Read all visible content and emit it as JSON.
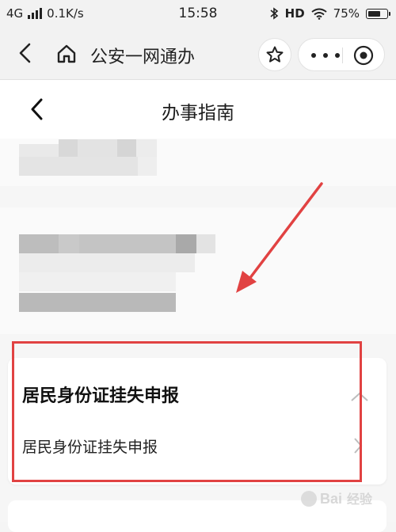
{
  "status_bar": {
    "network": "4G",
    "speed": "0.1K/s",
    "time": "15:58",
    "hd": "HD",
    "battery": "75%",
    "battery_level": 0.75
  },
  "app_bar": {
    "title": "公安一网通办",
    "icons": [
      "back-icon",
      "home-icon",
      "star-icon",
      "more-icon",
      "close-icon"
    ]
  },
  "page_header": {
    "title": "办事指南"
  },
  "section": {
    "heading": "居民身份证挂失申报",
    "sub_item": "居民身份证挂失申报"
  },
  "annotation": {
    "highlight_color": "#e14242"
  }
}
